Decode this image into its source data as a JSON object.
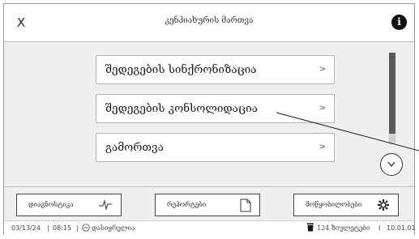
{
  "header": {
    "close_label": "X",
    "title": "კენჰიახურის მართვა",
    "info_label": "i"
  },
  "menu": {
    "items": [
      {
        "label": "შედეგების სინქრონიზაცია",
        "chevron": ">"
      },
      {
        "label": "შედეგების კონსოლიდაცია",
        "chevron": ">"
      },
      {
        "label": "გამორთვა",
        "chevron": ">"
      }
    ]
  },
  "scroll": {
    "down_icon": "chevron-down-icon",
    "position_fraction": 0.9
  },
  "toolbar": {
    "buttons": [
      {
        "label": "დიაგნოსტიკა",
        "icon": "waveform-icon"
      },
      {
        "label": "რეპორტები",
        "icon": "document-icon"
      },
      {
        "label": "მოწყობილობები",
        "icon": "gear-icon"
      }
    ]
  },
  "status": {
    "date": "03/13/24",
    "sep1": "|",
    "time": "08:15",
    "sep2": "|",
    "login_icon": "login-icon",
    "login_text": "დასიყრელია",
    "trash_icon": "trash-icon",
    "count_text": "124 ზიულეტები",
    "sep3": "I",
    "version": "10.01.01"
  }
}
